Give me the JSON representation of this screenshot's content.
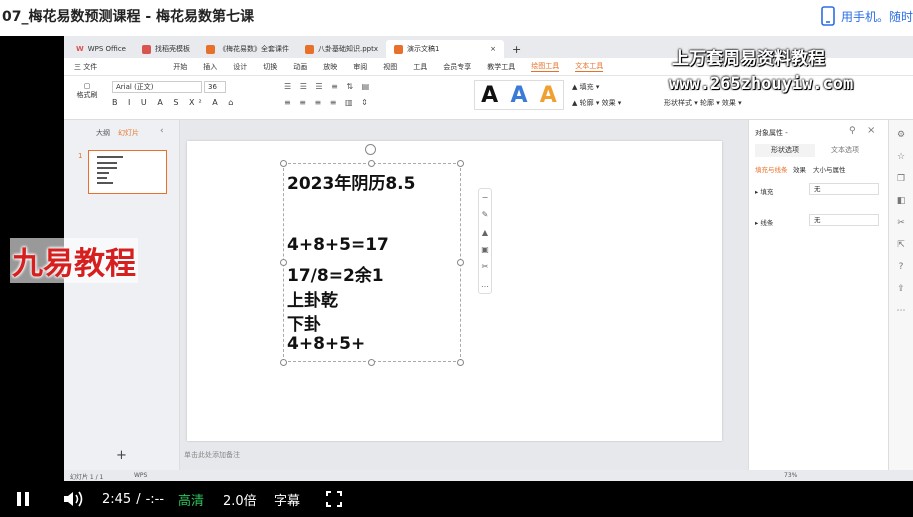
{
  "page": {
    "title": "07_梅花易数预测课程 - 梅花易数第七课",
    "phone_link": "用手机。随时"
  },
  "app": {
    "tabs": [
      {
        "label": "WPS Office"
      },
      {
        "label": "找稻壳模板"
      },
      {
        "label": "《梅花易数》全套课件"
      },
      {
        "label": "八卦基础知识.pptx"
      },
      {
        "label": "演示文稿1"
      }
    ],
    "menu": [
      "三 文件",
      "开始",
      "插入",
      "设计",
      "切换",
      "动画",
      "放映",
      "审阅",
      "视图",
      "工具",
      "会员专享",
      "教学工具",
      "绘图工具",
      "文本工具"
    ],
    "active_menu": "绘图工具",
    "font_name": "Arial (正文)",
    "font_size": "36",
    "left_panel": {
      "outline_tab": "大纲",
      "slides_tab": "幻灯片",
      "slide_number": "1",
      "add_button": "+"
    },
    "slide_lines": [
      "2023年阴历8.5",
      "",
      "4+8+5=17",
      "17/8=2余1",
      "上卦乾",
      "下卦",
      "4+8+5+"
    ],
    "notes_placeholder": "单击此处添加备注",
    "right_panel": {
      "title": "对象属性 -",
      "tab1": "形状选项",
      "tab2": "文本选项",
      "subtabs": [
        "填充与线条",
        "效果",
        "大小与属性"
      ],
      "fill_label": "▸ 填充",
      "fill_value": "无",
      "line_label": "▸ 线条",
      "line_value": "无"
    },
    "status": {
      "slide_info": "幻灯片 1 / 1",
      "theme": "WPS",
      "zoom": "73%"
    }
  },
  "watermarks": {
    "line1": "上万套周易资料教程",
    "line2": "www.265zhouyiw.com",
    "red": "九易教程"
  },
  "player": {
    "time": "2:45",
    "separator": "/",
    "duration": "-:--",
    "quality": "高清",
    "speed": "2.0倍",
    "subtitle": "字幕",
    "colors": {
      "quality": "#2fc25b",
      "accent": "#e8702a"
    }
  }
}
